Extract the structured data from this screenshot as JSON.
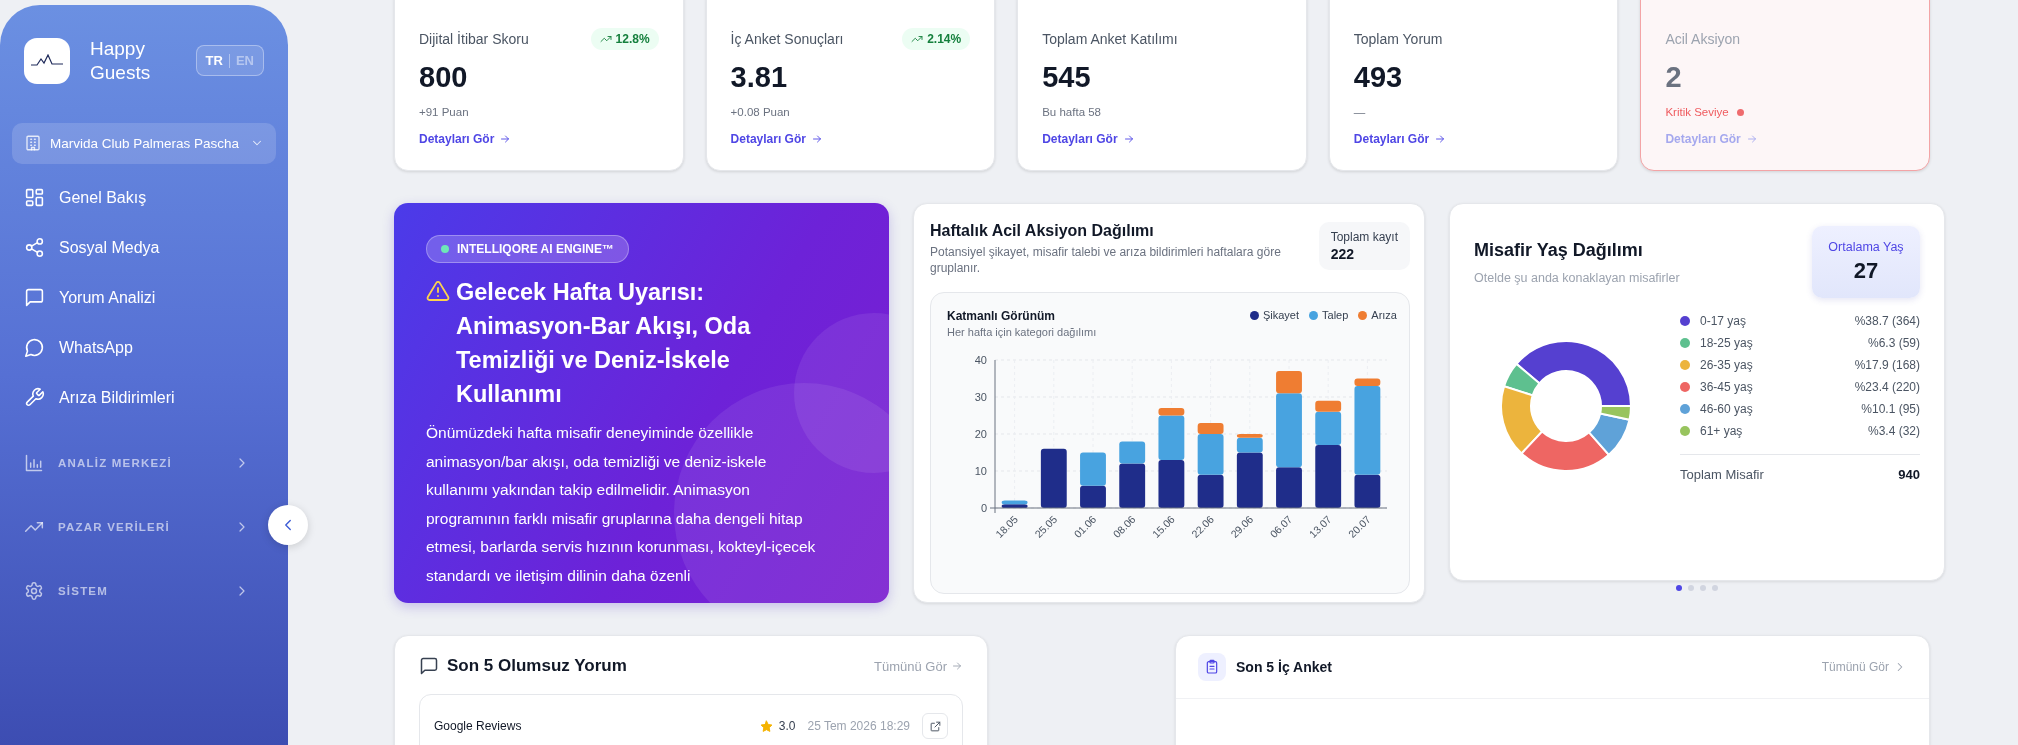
{
  "sidebar": {
    "brand": "Happy Guests",
    "languages": [
      {
        "label": "TR",
        "selected": true
      },
      {
        "label": "EN",
        "selected": false
      }
    ],
    "hotel_selector": "Marvida Club Palmeras Pascha",
    "items": [
      {
        "kind": "link",
        "label": "Genel Bakış"
      },
      {
        "kind": "link",
        "label": "Sosyal Medya"
      },
      {
        "kind": "link",
        "label": "Yorum Analizi"
      },
      {
        "kind": "link",
        "label": "WhatsApp"
      },
      {
        "kind": "link",
        "label": "Arıza Bildirimleri"
      },
      {
        "kind": "section",
        "label": "ANALİZ MERKEZİ"
      },
      {
        "kind": "section",
        "label": "PAZAR VERİLERİ"
      },
      {
        "kind": "section",
        "label": "SİSTEM"
      }
    ]
  },
  "kpis": [
    {
      "kind": "normal",
      "title": "Dijital İtibar Skoru",
      "value": "800",
      "change": "12.8%",
      "note": "+91 Puan",
      "link": "Detayları Gör"
    },
    {
      "kind": "normal",
      "title": "İç Anket Sonuçları",
      "value": "3.81",
      "change": "2.14%",
      "note": "+0.08 Puan",
      "link": "Detayları Gör"
    },
    {
      "kind": "normal",
      "title": "Toplam Anket Katılımı",
      "value": "545",
      "note": "Bu hafta 58",
      "link": "Detayları Gör"
    },
    {
      "kind": "normal",
      "title": "Toplam Yorum",
      "value": "493",
      "note": "—",
      "link": "Detayları Gör"
    },
    {
      "kind": "alert",
      "title": "Acil Aksiyon",
      "value": "2",
      "note": "Kritik Seviye",
      "link": "Detayları Gör"
    }
  ],
  "insight": {
    "badge": "INTELLIQORE AI ENGINE™",
    "title": "Gelecek Hafta Uyarısı: Animasyon-Bar Akışı, Oda Temizliği ve Deniz-İskele Kullanımı",
    "body": "Önümüzdeki hafta misafir deneyiminde özellikle animasyon/bar akışı, oda temizliği ve deniz-iskele kullanımı yakından takip edilmelidir. Animasyon programının farklı misafir gruplarına daha dengeli hitap etmesi, barlarda servis hızının korunması, kokteyl-içecek standardı ve iletişim dilinin daha özenli"
  },
  "weekly_actions": {
    "title": "Haftalık Acil Aksiyon Dağılımı",
    "subtitle": "Potansiyel şikayet, misafir talebi ve arıza bildirimleri haftalara göre gruplanır.",
    "total_label": "Toplam kayıt",
    "total_value": "222",
    "panel_title": "Katmanlı Görünüm",
    "panel_subtitle": "Her hafta için kategori dağılımı",
    "chart_data": {
      "type": "bar",
      "stacked": true,
      "grid": true,
      "categories": [
        "18.05",
        "25.05",
        "01.06",
        "08.06",
        "15.06",
        "22.06",
        "29.06",
        "06.07",
        "13.07",
        "20.07"
      ],
      "ylim": [
        0,
        40
      ],
      "yticks": [
        0,
        10,
        20,
        30,
        40
      ],
      "series": [
        {
          "name": "Şikayet",
          "color": "#1f2d8a",
          "values": [
            1,
            16,
            6,
            12,
            13,
            9,
            15,
            11,
            17,
            9
          ]
        },
        {
          "name": "Talep",
          "color": "#48a3e0",
          "values": [
            1,
            0,
            9,
            6,
            12,
            11,
            4,
            20,
            9,
            24
          ]
        },
        {
          "name": "Arıza",
          "color": "#ef7d32",
          "values": [
            0,
            0,
            0,
            0,
            2,
            3,
            1,
            6,
            3,
            2
          ]
        }
      ]
    }
  },
  "age_distribution": {
    "title": "Misafir Yaş Dağılımı",
    "subtitle": "Otelde şu anda konaklayan misafirler",
    "average_label": "Ortalama Yaş",
    "average_value": "27",
    "chart_data": {
      "type": "donut",
      "categories": [
        "0-17 yaş",
        "18-25 yaş",
        "26-35 yaş",
        "36-45 yaş",
        "46-60 yaş",
        "61+ yaş"
      ],
      "values": [
        38.7,
        6.3,
        17.9,
        23.4,
        10.1,
        3.4
      ]
    },
    "legend": [
      {
        "value": "%38.7 (364)",
        "color": "#5540d0"
      },
      {
        "value": "%6.3 (59)",
        "color": "#5ec08f"
      },
      {
        "value": "%17.9 (168)",
        "color": "#ecb43d"
      },
      {
        "value": "%23.4 (220)",
        "color": "#ee6663"
      },
      {
        "value": "%10.1 (95)",
        "color": "#5fa2d8"
      },
      {
        "value": "%3.4 (32)",
        "color": "#98c45e"
      }
    ],
    "total_label": "Toplam Misafir",
    "total_value": "940",
    "pages": [
      {
        "selected": true
      },
      {
        "selected": false
      },
      {
        "selected": false
      },
      {
        "selected": false
      }
    ]
  },
  "negative_reviews": {
    "title": "Son 5 Olumsuz Yorum",
    "view_all": "Tümünü Gör",
    "items": [
      {
        "source": "Google Reviews",
        "rating": "3.0",
        "date": "25 Tem 2026 18:29"
      }
    ]
  },
  "surveys": {
    "title": "Son 5 İç Anket",
    "view_all": "Tümünü Gör"
  }
}
